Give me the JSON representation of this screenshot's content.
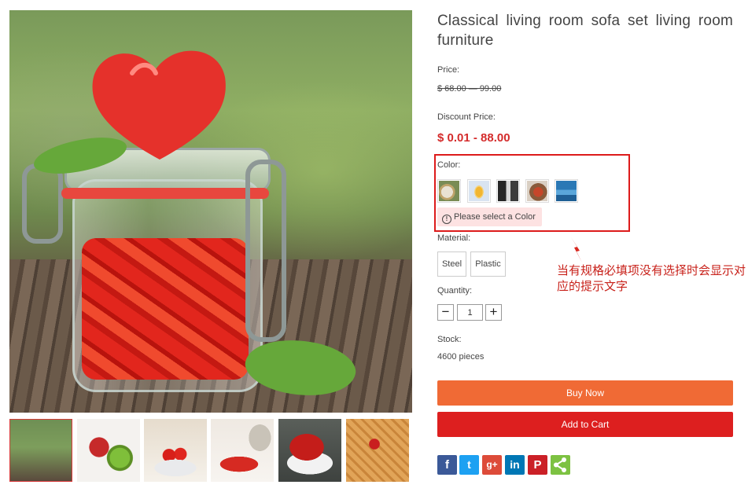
{
  "product": {
    "title": "Classical living room sofa set living room furniture",
    "price_label": "Price:",
    "price_original": "$ 68.00 — 99.00",
    "discount_label": "Discount Price:",
    "discount_price": "$ 0.01 - 88.00",
    "color_label": "Color:",
    "color_swatches": [
      "swatch-1",
      "swatch-2",
      "swatch-3",
      "swatch-4",
      "swatch-5"
    ],
    "color_warning": "Please select a Color",
    "material_label": "Material:",
    "material_options": [
      "Steel",
      "Plastic"
    ],
    "quantity_label": "Quantity:",
    "quantity_value": "1",
    "quantity_minus": "−",
    "quantity_plus": "+",
    "stock_label": "Stock:",
    "stock_value": "4600 pieces",
    "buy_now": "Buy Now",
    "add_to_cart": "Add to Cart"
  },
  "gallery": {
    "thumbnail_count": 6,
    "active_index": 0
  },
  "share": {
    "icons": [
      "facebook-icon",
      "twitter-icon",
      "google-plus-icon",
      "linkedin-icon",
      "pinterest-icon",
      "share-icon"
    ],
    "facebook": "f",
    "twitter": "t",
    "google_plus": "g+",
    "linkedin": "in",
    "pinterest": "P"
  },
  "annotation": {
    "note": "当有规格必填项没有选择时会显示对应的提示文字"
  },
  "colors": {
    "accent_red": "#dd1f1f",
    "buy_orange": "#f06a35",
    "price_red": "#d42b2b",
    "warning_bg": "#fde2e2"
  }
}
